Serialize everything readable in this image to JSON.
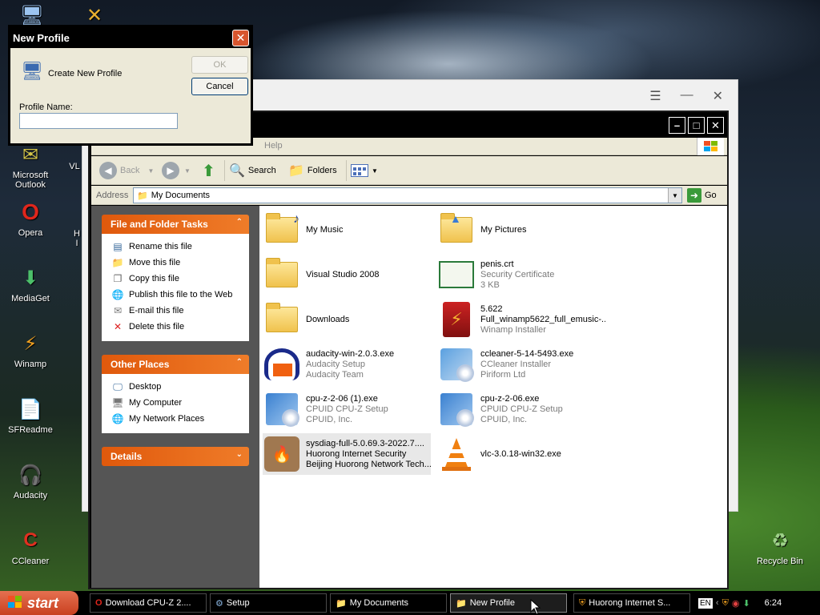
{
  "desktop": {
    "icons": [
      {
        "label": "Microsoft\nOutlook"
      },
      {
        "label": "Opera"
      },
      {
        "label": "MediaGet"
      },
      {
        "label": "Winamp"
      },
      {
        "label": "SFReadme"
      },
      {
        "label": "Audacity"
      },
      {
        "label": "CCleaner"
      },
      {
        "label": "Recycle Bin"
      }
    ],
    "partial": [
      "VL",
      "H",
      "I"
    ]
  },
  "explorer": {
    "menu_help": "Help",
    "toolbar": {
      "back": "Back",
      "search": "Search",
      "folders": "Folders"
    },
    "address": {
      "label": "Address",
      "value": "My Documents",
      "go": "Go"
    },
    "tasks_panel": {
      "title": "File and Folder Tasks",
      "items": [
        "Rename this file",
        "Move this file",
        "Copy this file",
        "Publish this file to the Web",
        "E-mail this file",
        "Delete this file"
      ]
    },
    "places_panel": {
      "title": "Other Places",
      "items": [
        "Desktop",
        "My Computer",
        "My Network Places"
      ]
    },
    "details_panel": {
      "title": "Details"
    },
    "files": [
      {
        "name": "My Music",
        "line2": "",
        "line3": ""
      },
      {
        "name": "My Pictures",
        "line2": "",
        "line3": ""
      },
      {
        "name": "Visual Studio 2008",
        "line2": "",
        "line3": ""
      },
      {
        "name": "penis.crt",
        "line2": "Security Certificate",
        "line3": "3 KB"
      },
      {
        "name": "Downloads",
        "line2": "",
        "line3": ""
      },
      {
        "name": "5.622",
        "line2": "Full_winamp5622_full_emusic-...",
        "line3": "Winamp Installer"
      },
      {
        "name": "audacity-win-2.0.3.exe",
        "line2": "Audacity Setup",
        "line3": "Audacity Team"
      },
      {
        "name": "ccleaner-5-14-5493.exe",
        "line2": "CCleaner Installer",
        "line3": "Piriform Ltd"
      },
      {
        "name": "cpu-z-2-06 (1).exe",
        "line2": "CPUID CPU-Z Setup",
        "line3": "CPUID, Inc."
      },
      {
        "name": "cpu-z-2-06.exe",
        "line2": "CPUID CPU-Z Setup",
        "line3": "CPUID, Inc."
      },
      {
        "name": "sysdiag-full-5.0.69.3-2022.7....",
        "line2": "Huorong Internet Security",
        "line3": "Beijing Huorong Network Tech...."
      },
      {
        "name": "vlc-3.0.18-win32.exe",
        "line2": "",
        "line3": ""
      }
    ]
  },
  "dialog": {
    "title": "New Profile",
    "heading": "Create New Profile",
    "field_label": "Profile Name:",
    "field_value": "",
    "ok": "OK",
    "cancel": "Cancel"
  },
  "taskbar": {
    "start": "start",
    "tasks": [
      {
        "label": "Download CPU-Z 2...."
      },
      {
        "label": "Setup"
      },
      {
        "label": "My Documents"
      },
      {
        "label": "New Profile"
      },
      {
        "label": "Huorong Internet S..."
      }
    ],
    "lang": "EN",
    "clock": "6:24"
  }
}
